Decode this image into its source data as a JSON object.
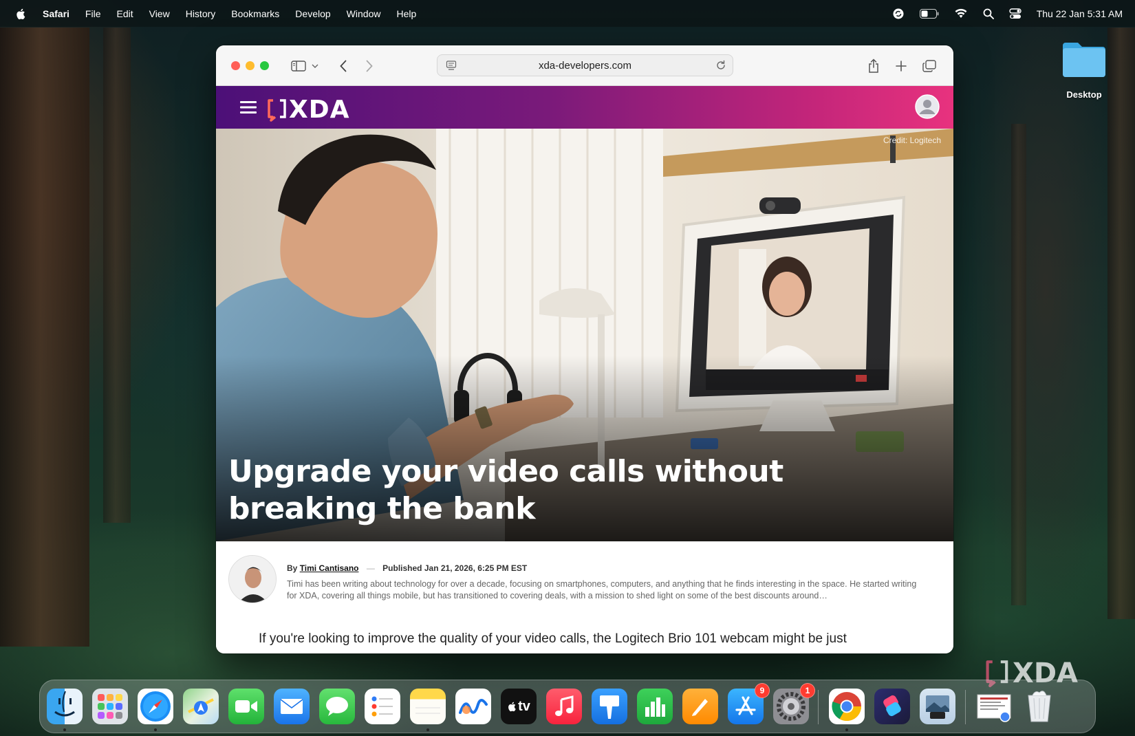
{
  "menubar": {
    "app_name": "Safari",
    "items": [
      "File",
      "Edit",
      "View",
      "History",
      "Bookmarks",
      "Develop",
      "Window",
      "Help"
    ],
    "clock": "Thu 22 Jan  5:31 AM"
  },
  "desktop": {
    "folder_label": "Desktop"
  },
  "browser": {
    "url": "xda-developers.com",
    "site_logo_text": "XDA",
    "hero_credit": "Credit: Logitech",
    "article_title": "Upgrade your video calls without breaking the bank",
    "byline_prefix": "By",
    "author": "Timi Cantisano",
    "published": "Published Jan 21, 2026, 6:25 PM EST",
    "bio": "Timi has been writing about technology for over a decade, focusing on smartphones, computers, and anything that he finds interesting in the space. He started writing for XDA, covering all things mobile, but has transitioned to covering deals, with a mission to shed light on some of the best discounts around…",
    "lede": "If you're looking to improve the quality of your video calls, the Logitech Brio 101 webcam might be just"
  },
  "dock": {
    "apps": [
      {
        "name": "Finder"
      },
      {
        "name": "Launchpad"
      },
      {
        "name": "Safari"
      },
      {
        "name": "Maps"
      },
      {
        "name": "FaceTime"
      },
      {
        "name": "Mail"
      },
      {
        "name": "Messages"
      },
      {
        "name": "Reminders"
      },
      {
        "name": "Notes"
      },
      {
        "name": "Freeform"
      },
      {
        "name": "TV",
        "label": "tv"
      },
      {
        "name": "Music"
      },
      {
        "name": "Keynote"
      },
      {
        "name": "Numbers"
      },
      {
        "name": "Pages"
      },
      {
        "name": "App Store",
        "badge": "9"
      },
      {
        "name": "System Settings",
        "badge": "1"
      },
      {
        "name": "Chrome"
      },
      {
        "name": "Shortcuts"
      },
      {
        "name": "Preview"
      },
      {
        "name": "Recent Document"
      },
      {
        "name": "Trash"
      }
    ],
    "watermark_text": "XDA"
  },
  "colors": {
    "xda_gradient_start": "#4c1078",
    "xda_gradient_end": "#e8327e",
    "badge": "#ff3b30"
  }
}
